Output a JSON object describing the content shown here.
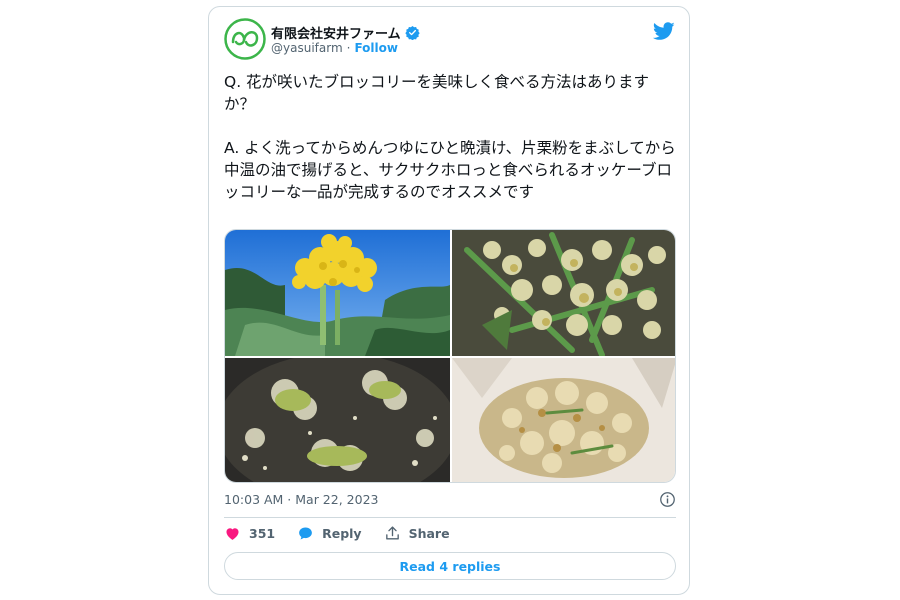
{
  "author": {
    "name": "有限会社安井ファーム",
    "handle": "@yasuifarm",
    "separator": "·",
    "follow_label": "Follow",
    "verified": true
  },
  "tweet": {
    "text": "Q. 花が咲いたブロッコリーを美味しく食べる方法はありますか？\n\nA. よく洗ってからめんつゆにひと晩漬け、片栗粉をまぶしてから中温の油で揚げると、サクサクホロっと食べられるオッケーブロッコリーな一品が完成するのでオススメです",
    "timestamp": "10:03 AM · Mar 22, 2023"
  },
  "media": {
    "photos": [
      {
        "icon": "flowering-broccoli-photo"
      },
      {
        "icon": "washed-broccoli-flowers-photo"
      },
      {
        "icon": "frying-broccoli-photo"
      },
      {
        "icon": "fried-broccoli-photo"
      }
    ]
  },
  "actions": {
    "like_count": "351",
    "reply_label": "Reply",
    "share_label": "Share"
  },
  "footer": {
    "read_replies_label": "Read 4 replies"
  },
  "colors": {
    "accent": "#1d9bf0",
    "like": "#f91880",
    "logo_green": "#3cb54a",
    "secondary_text": "#536471"
  }
}
